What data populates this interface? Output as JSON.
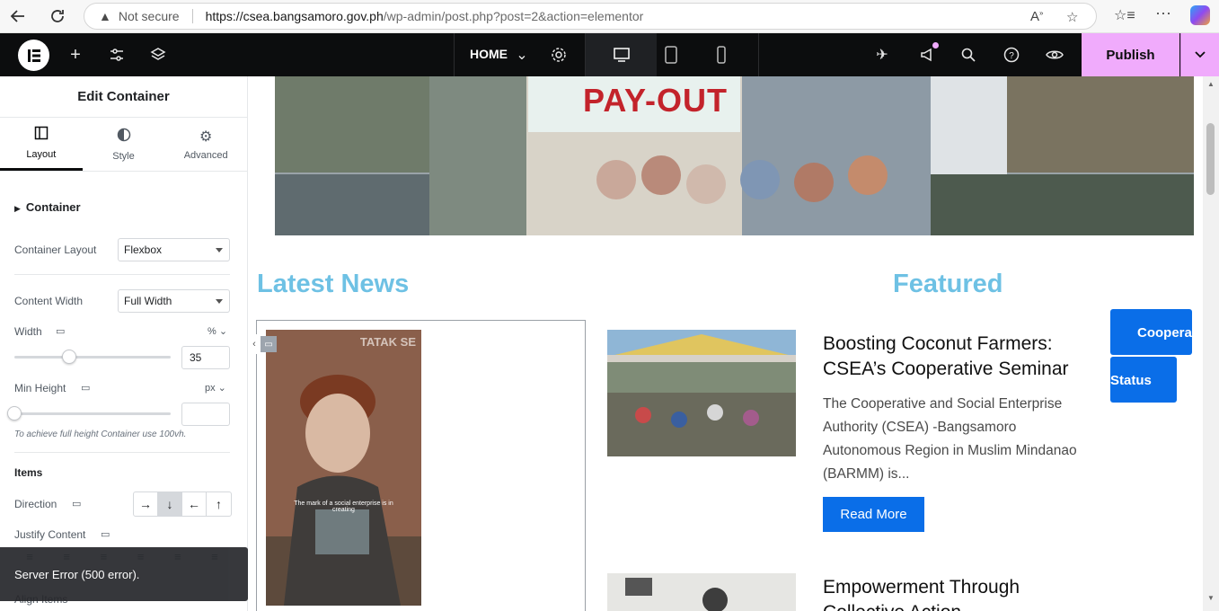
{
  "browser": {
    "security_label": "Not secure",
    "url_host": "https://csea.bangsamoro.gov.ph",
    "url_path": "/wp-admin/post.php?post=2&action=elementor"
  },
  "topbar": {
    "page_name": "HOME",
    "publish_label": "Publish"
  },
  "panel": {
    "title": "Edit Container",
    "tabs": [
      {
        "label": "Layout",
        "icon": "layout-icon",
        "active": true
      },
      {
        "label": "Style",
        "icon": "style-icon",
        "active": false
      },
      {
        "label": "Advanced",
        "icon": "gear-icon",
        "active": false
      }
    ],
    "section": "Container",
    "container_layout": {
      "label": "Container Layout",
      "value": "Flexbox"
    },
    "content_width": {
      "label": "Content Width",
      "value": "Full Width"
    },
    "width": {
      "label": "Width",
      "unit": "%",
      "value": "35",
      "slider_fraction": 0.35
    },
    "min_height": {
      "label": "Min Height",
      "unit": "px",
      "value": "",
      "slider_fraction": 0
    },
    "note": "To achieve full height Container use 100vh.",
    "items_heading": "Items",
    "direction": {
      "label": "Direction",
      "options": [
        "→",
        "↓",
        "←",
        "↑"
      ],
      "active_index": 1
    },
    "justify_label": "Justify Content",
    "align_label": "Align Items",
    "toast": "Server Error (500 error)."
  },
  "canvas": {
    "latest_news": "Latest News",
    "featured": "Featured",
    "video_watermark": "TATAK SE",
    "video_caption": "The mark of a social enterprise is in creating",
    "banner_text": "PAY-OUT",
    "posts": [
      {
        "title": "Boosting Coconut Farmers: CSEA’s Cooperative Seminar",
        "excerpt": "The Cooperative and Social Enterprise Authority (CSEA) -Bangsamoro Autonomous Region in Muslim Mindanao (BARMM) is...",
        "button": "Read More"
      },
      {
        "title": "Empowerment Through Collective Action",
        "excerpt": "",
        "button": ""
      }
    ],
    "side_buttons": [
      "Cooperatives",
      "Status"
    ]
  }
}
